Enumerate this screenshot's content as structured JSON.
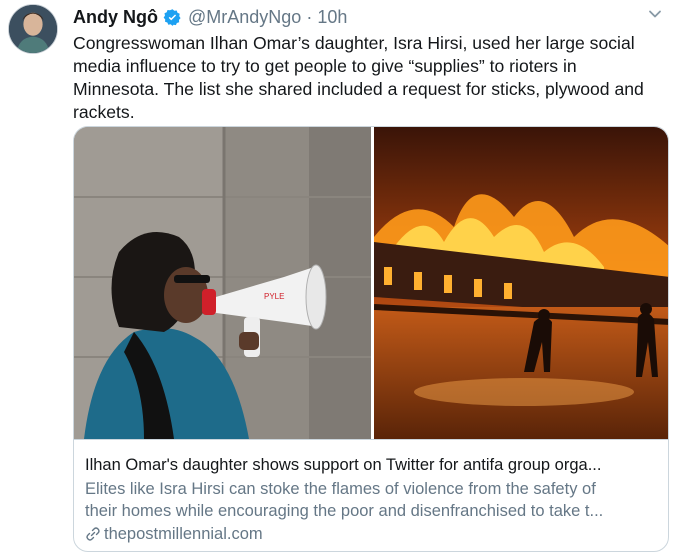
{
  "tweet": {
    "author_name": "Andy Ngô",
    "handle": "@MrAndyNgo",
    "separator": "·",
    "timestamp": "10h",
    "text_lines": [
      "Congresswoman Ilhan Omar’s daughter, Isra Hirsi, used her large social",
      "media influence to try to get people to give “supplies” to rioters in",
      "Minnesota. The list she shared included a request for sticks, plywood and",
      "rackets."
    ]
  },
  "card": {
    "title": "Ilhan Omar's daughter shows support on Twitter for antifa group orga...",
    "description_lines": [
      "Elites like Isra Hirsi can stoke the flames of violence from the safety of",
      "their homes while encouraging the poor and disenfranchised to take t..."
    ],
    "domain": "thepostmillennial.com",
    "megaphone_brand": "PYLE"
  },
  "icons": {
    "verified": "verified-badge-icon",
    "caret": "chevron-down-icon",
    "link": "link-icon"
  },
  "colors": {
    "verified_blue": "#1da1f2",
    "secondary_text": "#657786",
    "border": "#ccd6dd"
  }
}
